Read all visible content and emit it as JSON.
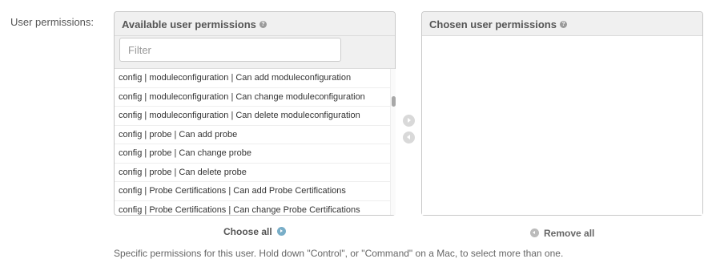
{
  "field_label": "User permissions:",
  "available": {
    "title": "Available user permissions",
    "filter_placeholder": "Filter",
    "options": [
      "config | moduleconfiguration | Can add moduleconfiguration",
      "config | moduleconfiguration | Can change moduleconfiguration",
      "config | moduleconfiguration | Can delete moduleconfiguration",
      "config | probe | Can add probe",
      "config | probe | Can change probe",
      "config | probe | Can delete probe",
      "config | Probe Certifications | Can add Probe Certifications",
      "config | Probe Certifications | Can change Probe Certifications"
    ],
    "choose_all_label": "Choose all"
  },
  "chosen": {
    "title": "Chosen user permissions",
    "options": [],
    "remove_all_label": "Remove all"
  },
  "help_text": "Specific permissions for this user. Hold down \"Control\", or \"Command\" on a Mac, to select more than one.",
  "icons": {
    "help": "help-icon",
    "add": "arrow-right-icon",
    "remove": "arrow-left-icon",
    "choose_all": "arrow-right-circle-icon",
    "remove_all": "arrow-left-circle-icon"
  },
  "colors": {
    "choose_all_icon": "#79aec8",
    "remove_all_icon": "#bbbbbb"
  }
}
